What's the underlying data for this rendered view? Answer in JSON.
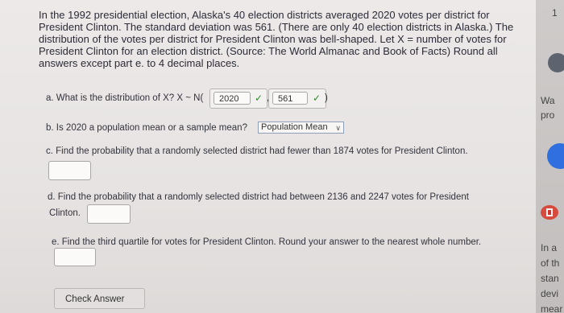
{
  "intro": "In the 1992 presidential election, Alaska's 40 election districts averaged 2020 votes per district for President Clinton. The standard deviation was 561. (There are only 40 election districts in Alaska.) The distribution of the votes per district for President Clinton was bell-shaped. Let X = number of votes for President Clinton for an election district. (Source: The World Almanac and Book of Facts) Round all answers except part e. to 4 decimal places.",
  "part_a": {
    "prefix": "a. What is the distribution of X? X ~ N(",
    "mean_value": "2020",
    "sd_value": "561",
    "separator": ",",
    "suffix": ")"
  },
  "part_b": {
    "prefix": "b. Is 2020 a population mean or a sample mean?",
    "selected": "Population Mean"
  },
  "part_c": {
    "text": "c. Find the probability that a randomly selected district had fewer than 1874 votes for President Clinton.",
    "value": ""
  },
  "part_d": {
    "line1": "d. Find the probability that a randomly selected district had between 2136 and 2247 votes for President",
    "line2": "Clinton.",
    "value": ""
  },
  "part_e": {
    "text": "e. Find the third quartile for votes for President Clinton. Round your answer to the nearest whole number.",
    "value": ""
  },
  "check_button": "Check Answer",
  "side_panel": {
    "top": "1",
    "wa": "Wa",
    "pro": "pro",
    "in_a": "In a",
    "of_th": "of th",
    "stan": "stan",
    "devi": "devi",
    "mear": "mear"
  },
  "colors": {
    "accent_blue": "#2f6fe0",
    "check_green": "#2f8a2f",
    "flag_red": "#d0342c"
  }
}
